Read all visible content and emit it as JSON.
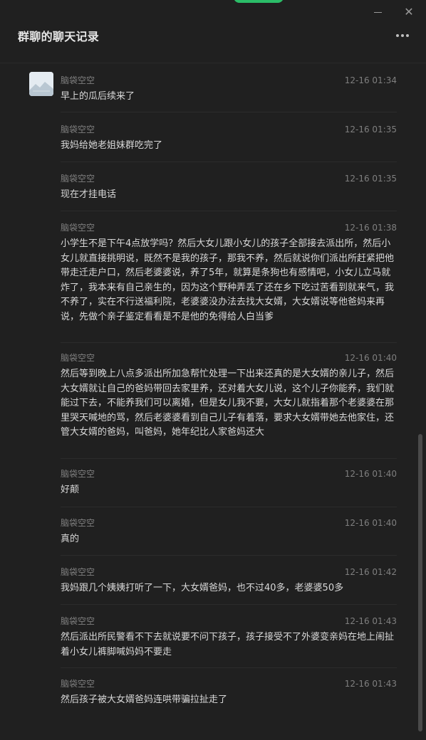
{
  "window": {
    "title": "群聊的聊天记录",
    "minimize_glyph": "",
    "close_glyph": "✕",
    "more_icon": "more-icon"
  },
  "messages": [
    {
      "sender": "脑袋空空",
      "time": "12-16 01:34",
      "text": "早上的瓜后续来了"
    },
    {
      "sender": "脑袋空空",
      "time": "12-16 01:35",
      "text": "我妈给她老姐妹群吃完了"
    },
    {
      "sender": "脑袋空空",
      "time": "12-16 01:35",
      "text": "现在才挂电话"
    },
    {
      "sender": "脑袋空空",
      "time": "12-16 01:38",
      "text": "小学生不是下午4点放学吗？然后大女儿跟小女儿的孩子全部接去派出所，然后小女儿就直接挑明说，既然不是我的孩子，那我不养，然后就说你们派出所赶紧把他带走迁走户口，然后老婆婆说，养了5年，就算是条狗也有感情吧，小女儿立马就炸了，我本来有自己亲生的，因为这个野种弄丢了还在乡下吃过苦看到就来气，我不养了，实在不行送福利院，老婆婆没办法去找大女婿，大女婿说等他爸妈来再说，先做个亲子鉴定看看是不是他的免得给人白当爹"
    },
    {
      "sender": "脑袋空空",
      "time": "12-16 01:40",
      "text": "然后等到晚上八点多派出所加急帮忙处理一下出来还真的是大女婿的亲儿子，然后大女婿就让自己的爸妈带回去家里养，还对着大女儿说，这个儿子你能养，我们就能过下去，不能养我们可以离婚，但是女儿我不要，大女儿就指着那个老婆婆在那里哭天喊地的骂，然后老婆婆看到自己儿子有着落，要求大女婿带她去他家住，还管大女婿的爸妈，叫爸妈，她年纪比人家爸妈还大"
    },
    {
      "sender": "脑袋空空",
      "time": "12-16 01:40",
      "text": "好颠"
    },
    {
      "sender": "脑袋空空",
      "time": "12-16 01:40",
      "text": "真的"
    },
    {
      "sender": "脑袋空空",
      "time": "12-16 01:42",
      "text": "我妈跟几个姨姨打听了一下，大女婿爸妈，也不过40多，老婆婆50多"
    },
    {
      "sender": "脑袋空空",
      "time": "12-16 01:43",
      "text": "然后派出所民警看不下去就说要不问下孩子，孩子接受不了外婆变亲妈在地上闹扯着小女儿裤脚喊妈妈不要走"
    },
    {
      "sender": "脑袋空空",
      "time": "12-16 01:43",
      "text": "然后孩子被大女婿爸妈连哄带骗拉扯走了"
    }
  ]
}
